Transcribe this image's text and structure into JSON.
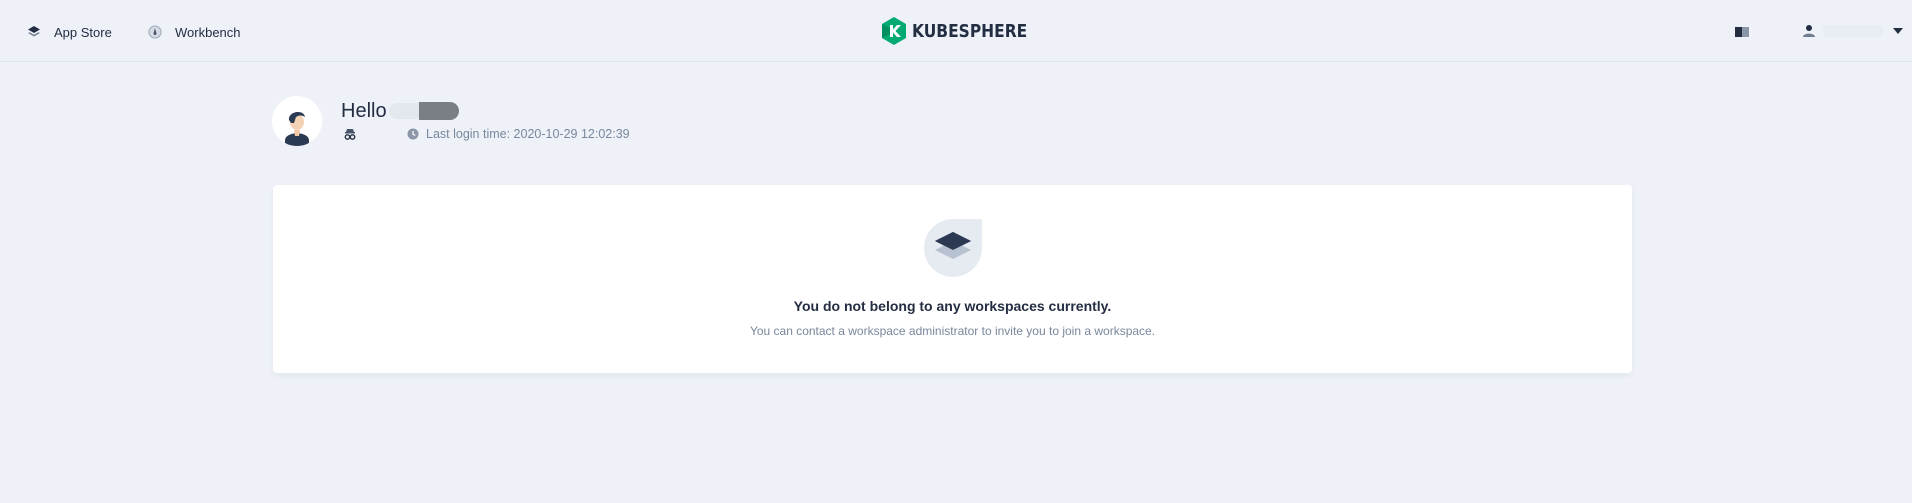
{
  "nav": {
    "app_store": {
      "label": "App Store",
      "icon": "app-store-icon"
    },
    "workbench": {
      "label": "Workbench",
      "icon": "workbench-icon"
    }
  },
  "logo": {
    "text": "KUBESPHERE",
    "brand_color": "#00aa72"
  },
  "header_right": {
    "docs_icon": "book-icon",
    "user_icon": "user-icon",
    "dropdown_icon": "caret-down-icon"
  },
  "greeting": {
    "hello": "Hello",
    "last_login": "Last login time: 2020-10-29 12:02:39"
  },
  "empty_state": {
    "title": "You do not belong to any workspaces currently.",
    "description": "You can contact a workspace administrator to invite you to join a workspace.",
    "icon": "workspace-layers-icon"
  },
  "colors": {
    "background": "#eef2f8",
    "panel": "#ffffff",
    "text_primary": "#242e42",
    "text_secondary": "#79879c"
  }
}
